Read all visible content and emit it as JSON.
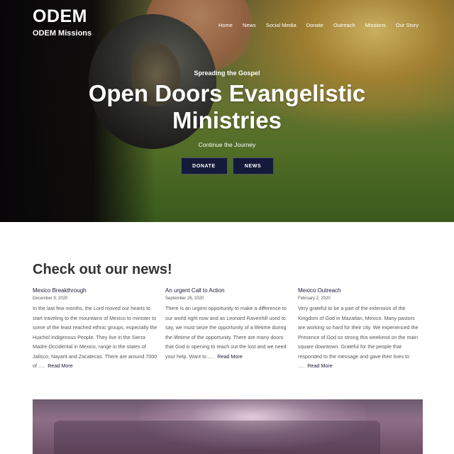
{
  "brand": {
    "logo": "ODEM",
    "subtitle": "ODEM Missions"
  },
  "nav": {
    "items": [
      "Home",
      "News",
      "Social Media",
      "Donate",
      "Outreach",
      "Missions",
      "Our Story"
    ]
  },
  "hero": {
    "kicker": "Spreading the Gospel",
    "title_line1": "Open Doors Evangelistic",
    "title_line2": "Ministries",
    "tagline": "Continue the Journey",
    "donate_label": "DONATE",
    "news_label": "NEWS"
  },
  "news": {
    "heading": "Check out our news!",
    "posts": [
      {
        "title": "Mexico Breakthrough",
        "date": "December 9, 2020",
        "excerpt": "In the last few months, the Lord moved our hearts to start traveling to the mountains of Mexico to minister to some of the least reached ethnic groups, especially the Huichol Indigenous People. They live in the Sierra Madre Occidental in Mexico, range in the states of Jalisco, Nayarit and Zacatecas. There are around 7000 of ….",
        "read_more": "Read More"
      },
      {
        "title": "An urgent Call to Action",
        "date": "September 26, 2020",
        "excerpt": "There is an urgent opportunity to make a difference to our world right now and as Leonard Ravenhill used to say, we must seize the opportunity of a lifetime during the lifetime of the opportunity.  There are many doors that God is opening to reach out the lost  and we need your help. Want to ….",
        "read_more": "Read More"
      },
      {
        "title": "Mexico Outreach",
        "date": "February 2, 2020",
        "excerpt": "Very grateful to be a part of the extension of the Kingdom of God in Mazatlan, Mexico. Many pastors are working so hard for their city. We experienced the Presence of God so strong this weekend on the main square downtown. Grateful for the people that responded to the message and gave their lives to ….",
        "read_more": "Read More"
      }
    ]
  }
}
